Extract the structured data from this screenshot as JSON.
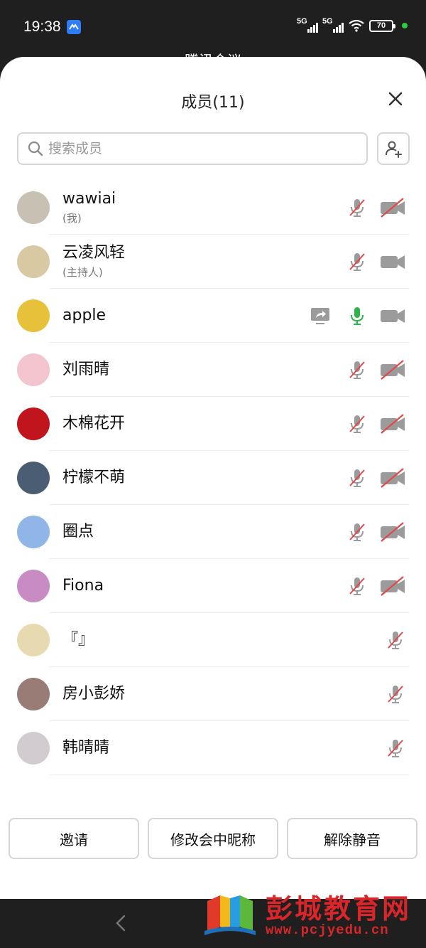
{
  "status_bar": {
    "time": "19:38",
    "network_1": "5G",
    "network_2": "5G",
    "battery": "70"
  },
  "header_peek": "腾讯会议",
  "sheet": {
    "title": "成员(11)"
  },
  "search": {
    "placeholder": "搜索成员",
    "value": ""
  },
  "members": [
    {
      "name": "wawiai",
      "sub": "(我)",
      "mic": "muted",
      "camera": "off",
      "share": false,
      "avatar_color": "#c7c0b3"
    },
    {
      "name": "云凌风轻",
      "sub": "(主持人)",
      "mic": "muted",
      "camera": "on",
      "share": false,
      "avatar_color": "#d9c9a3"
    },
    {
      "name": "apple",
      "sub": "",
      "mic": "active",
      "camera": "on",
      "share": true,
      "avatar_color": "#e8c13a"
    },
    {
      "name": "刘雨晴",
      "sub": "",
      "mic": "muted",
      "camera": "off",
      "share": false,
      "avatar_color": "#f3c6cf"
    },
    {
      "name": "木棉花开",
      "sub": "",
      "mic": "muted",
      "camera": "off",
      "share": false,
      "avatar_color": "#c0151d"
    },
    {
      "name": "柠檬不萌",
      "sub": "",
      "mic": "muted",
      "camera": "off",
      "share": false,
      "avatar_color": "#4a5d73"
    },
    {
      "name": "圈点",
      "sub": "",
      "mic": "muted",
      "camera": "off",
      "share": false,
      "avatar_color": "#8fb6e6"
    },
    {
      "name": "Fiona",
      "sub": "",
      "mic": "muted",
      "camera": "off",
      "share": false,
      "avatar_color": "#c98bc4"
    },
    {
      "name": "『』",
      "sub": "",
      "mic": "muted",
      "camera": "none",
      "share": false,
      "avatar_color": "#e7d9b0"
    },
    {
      "name": "房小彭娇",
      "sub": "",
      "mic": "muted",
      "camera": "none",
      "share": false,
      "avatar_color": "#9a7c77"
    },
    {
      "name": "韩晴晴",
      "sub": "",
      "mic": "muted",
      "camera": "none",
      "share": false,
      "avatar_color": "#d2cbd0"
    }
  ],
  "buttons": {
    "invite": "邀请",
    "rename": "修改会中昵称",
    "unmute_all": "解除静音"
  },
  "watermark": {
    "title": "彭城教育网",
    "url": "www.pcjyedu.cn"
  },
  "colors": {
    "mute_slash": "#e24a4a",
    "mic_active": "#2fb44a",
    "icon_grey": "#9b9b9b",
    "watermark_red": "#d8262a"
  }
}
